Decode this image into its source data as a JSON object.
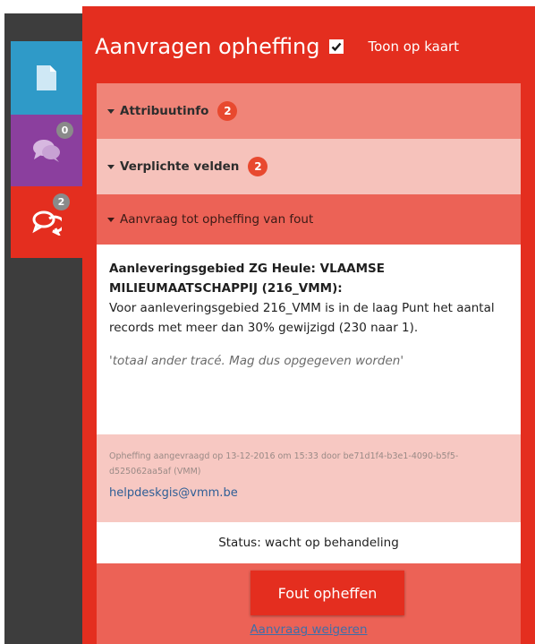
{
  "sidebar": {
    "tabs": [
      {
        "name": "document",
        "icon": "document-icon",
        "badge": ""
      },
      {
        "name": "messages",
        "icon": "chat-bubbles-icon",
        "badge": "0"
      },
      {
        "name": "requests",
        "icon": "chat-bubbles-icon",
        "badge": "2"
      }
    ],
    "colors": {
      "document": "#2f9ac8",
      "messages": "#8b3f9e",
      "requests": "#e42e1f"
    }
  },
  "header": {
    "title": "Aanvragen opheffing",
    "checkbox_checked": true,
    "map_link": "Toon op kaart"
  },
  "sections": {
    "attribute_info": {
      "label": "Attribuutinfo",
      "badge": "2"
    },
    "required_fields": {
      "label": "Verplichte velden",
      "badge": "2"
    },
    "request": {
      "label": "Aanvraag tot opheffing van fout"
    }
  },
  "detail": {
    "heading": "Aanleveringsgebied ZG Heule: VLAAMSE MILIEUMAATSCHAPPIJ (216_VMM):",
    "body": "Voor aanleveringsgebied 216_VMM is in de laag Punt het aantal records met meer dan 30% gewijzigd (230 naar 1).",
    "quote": "'totaal ander tracé. Mag dus opgegeven worden'"
  },
  "meta": {
    "text": "Opheffing aangevraagd op 13-12-2016 om 15:33 door be71d1f4-b3e1-4090-b5f5-d525062aa5af (VMM)",
    "email": "helpdeskgis@vmm.be"
  },
  "status": {
    "text": "Status: wacht op behandeling"
  },
  "actions": {
    "primary": "Fout opheffen",
    "reject": "Aanvraag weigeren"
  },
  "colors": {
    "accent": "#e42e1f",
    "panel": "#e42e1f",
    "link": "#2e5e96"
  }
}
